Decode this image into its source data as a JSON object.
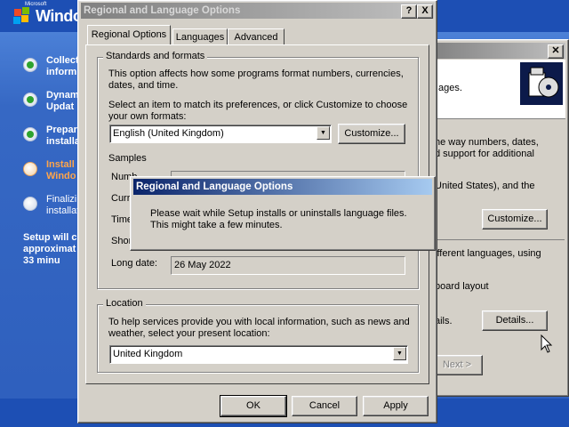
{
  "setup": {
    "logo_small": "Microsoft",
    "logo_text": "Windo",
    "steps": [
      {
        "label": "Collect\ninform",
        "state": "done"
      },
      {
        "label": "Dynam\nUpdat",
        "state": "done"
      },
      {
        "label": "Prepar\ninstalla",
        "state": "done"
      },
      {
        "label": "Install\nWindo",
        "state": "current"
      },
      {
        "label": "Finalizi\ninstallat",
        "state": "pending"
      }
    ],
    "time_estimate": "Setup will c\napproximat\n33 minu"
  },
  "bg_dialog": {
    "text1": "ages.",
    "text2": "he way numbers, dates,\nd support for additional",
    "text3": "United States), and the",
    "customize_label": "Customize...",
    "text4": "ifferent languages, using",
    "text5": "board layout",
    "text6": "ails.",
    "details_label": "Details...",
    "next_label": "Next >"
  },
  "main_dialog": {
    "title": "Regional and Language Options",
    "help_btn": "?",
    "close_btn": "X",
    "tabs": [
      "Regional Options",
      "Languages",
      "Advanced"
    ],
    "standards_group": "Standards and formats",
    "standards_desc": "This option affects how some programs format numbers, currencies, dates, and time.",
    "select_desc": "Select an item to match its preferences, or click Customize to choose your own formats:",
    "format_value": "English (United Kingdom)",
    "customize_label": "Customize...",
    "samples_label": "Samples",
    "sample_labels": [
      "Numb",
      "Curre",
      "Time",
      "Shor",
      "Long date:"
    ],
    "long_date_value": "26 May 2022",
    "location_group": "Location",
    "location_desc": "To help services provide you with local information, such as news and weather, select your present location:",
    "location_value": "United Kingdom",
    "ok_label": "OK",
    "cancel_label": "Cancel",
    "apply_label": "Apply"
  },
  "wait_dialog": {
    "title": "Regional and Language Options",
    "message": "Please wait while Setup installs or uninstalls language files. This might take a few minutes."
  },
  "colors": {
    "title_active": "#0a246a",
    "face": "#d4d0c8",
    "setup_blue": "#3a6ec9",
    "current_step": "#ffa54a"
  }
}
